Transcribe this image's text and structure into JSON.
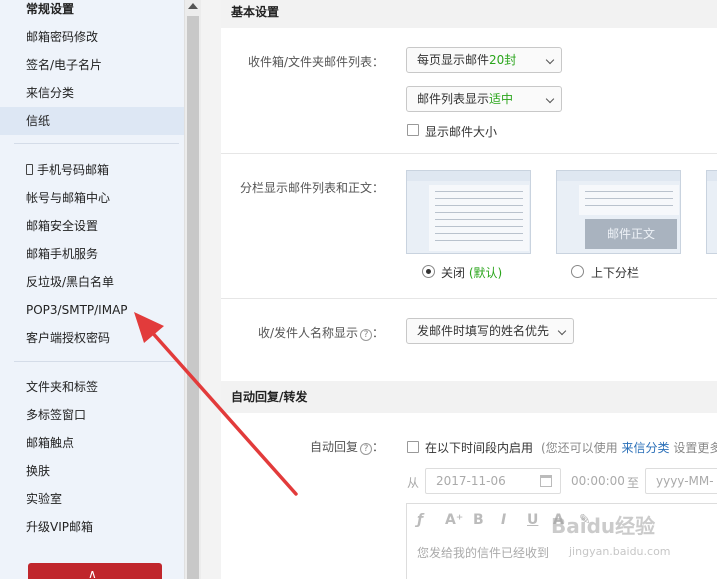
{
  "sidebar": {
    "group1": [
      "常规设置",
      "邮箱密码修改",
      "签名/电子名片",
      "来信分类",
      "信纸"
    ],
    "group2": [
      "手机号码邮箱",
      "帐号与邮箱中心",
      "邮箱安全设置",
      "邮箱手机服务",
      "反垃圾/黑白名单",
      "POP3/SMTP/IMAP",
      "客户端授权密码"
    ],
    "group3": [
      "文件夹和标签",
      "多标签窗口",
      "邮箱触点",
      "换肤",
      "实验室",
      "升级VIP邮箱"
    ],
    "active_item": "信纸"
  },
  "basic_settings": {
    "title": "基本设置",
    "list_label": "收件箱/文件夹邮件列表：",
    "per_page_prefix": "每页显示邮件",
    "per_page_value": "20封",
    "list_display_prefix": "邮件列表显示",
    "list_display_value": "适中",
    "show_size_label": "显示邮件大小",
    "split_label": "分栏显示邮件列表和正文：",
    "split_option_off": "关闭",
    "split_option_off_default": "(默认)",
    "split_option_updown": "上下分栏",
    "thumb_body_text": "邮件正文",
    "sender_label": "收/发件人名称显示",
    "sender_select": "发邮件时填写的姓名优先"
  },
  "auto_reply": {
    "title": "自动回复/转发",
    "label": "自动回复",
    "checkbox_label": "在以下时间段内启用",
    "hint_prefix": "(您还可以使用",
    "hint_link": "来信分类",
    "hint_suffix": "设置更多",
    "from_label": "从",
    "start_date": "2017-11-06",
    "start_time": "00:00:00",
    "to_label": "至",
    "end_date_placeholder": "yyyy-MM-",
    "editor_text": "您发给我的信件已经收到",
    "watermark": "Baidu经验",
    "watermark_sub": "jingyan.baidu.com"
  },
  "colors": {
    "sidebar_bg": "#eef3fa",
    "accent_green": "#2aa51b",
    "link_blue": "#2a6fb8",
    "arrow_red": "#e23b3b"
  }
}
